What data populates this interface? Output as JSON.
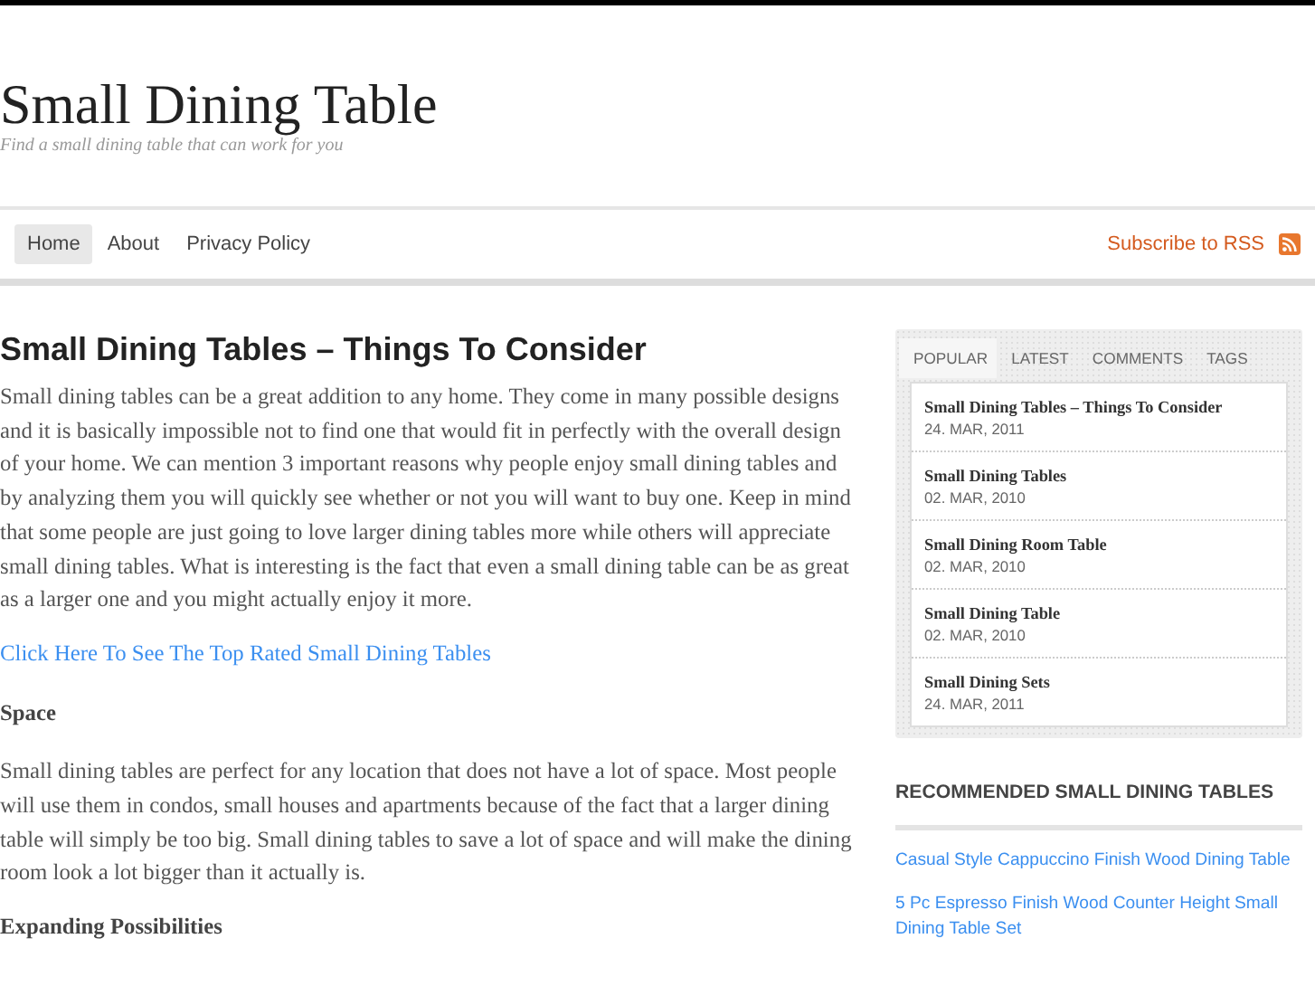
{
  "site": {
    "title": "Small Dining Table",
    "tagline": "Find a small dining table that can work for you"
  },
  "nav": {
    "items": [
      {
        "label": "Home",
        "selected": true
      },
      {
        "label": "About",
        "selected": false
      },
      {
        "label": "Privacy Policy",
        "selected": false
      }
    ],
    "subscribe": "Subscribe to RSS"
  },
  "article": {
    "title": "Small Dining Tables – Things To Consider",
    "blocks": [
      {
        "kind": "paragraph",
        "text": "Small dining tables can be a great addition to any home. They come in many possible designs and it is basically impossible not to find one that would fit in perfectly with the overall design of your home. We can mention 3 important reasons why people enjoy small dining tables and by analyzing them you will quickly see whether or not you will want to buy one. Keep in mind that some people are just going to love larger dining tables more while others will appreciate small dining tables. What is interesting is the fact that even a small dining table can be as great as a larger one and you might actually enjoy it more."
      },
      {
        "kind": "link",
        "text": "Click Here To See The Top Rated Small Dining Tables"
      },
      {
        "kind": "heading",
        "text": "Space"
      },
      {
        "kind": "paragraph",
        "text": "Small dining tables are perfect for any location that does not have a lot of space. Most people will use them in condos, small houses and apartments because of the fact that a larger dining table will simply be too big. Small dining tables to save a lot of space and will make the dining room look a lot bigger than it actually is."
      },
      {
        "kind": "heading",
        "text": "Expanding Possibilities"
      }
    ]
  },
  "sidebar": {
    "tabs": [
      {
        "label": "POPULAR",
        "selected": true
      },
      {
        "label": "LATEST",
        "selected": false
      },
      {
        "label": "COMMENTS",
        "selected": false
      },
      {
        "label": "TAGS",
        "selected": false
      }
    ],
    "posts": [
      {
        "title": "Small Dining Tables – Things To Consider",
        "date": "24. MAR, 2011"
      },
      {
        "title": "Small Dining Tables",
        "date": "02. MAR, 2010"
      },
      {
        "title": "Small Dining Room Table",
        "date": "02. MAR, 2010"
      },
      {
        "title": "Small Dining Table",
        "date": "02. MAR, 2010"
      },
      {
        "title": "Small Dining Sets",
        "date": "24. MAR, 2011"
      }
    ],
    "recommended": {
      "heading": "RECOMMENDED SMALL DINING TABLES",
      "links": [
        "Casual Style Cappuccino Finish Wood Dining Table",
        "5 Pc Espresso Finish Wood Counter Height Small Dining Table Set"
      ]
    }
  }
}
